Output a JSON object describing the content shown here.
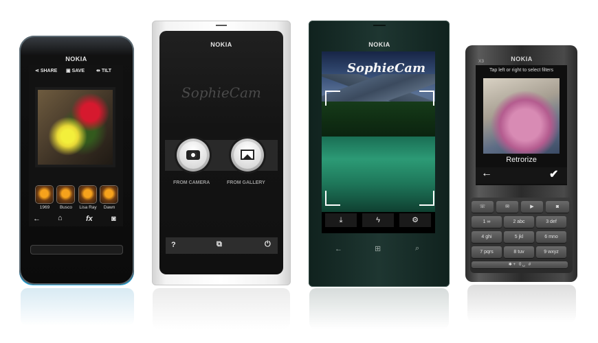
{
  "phone1": {
    "brand": "NOKIA",
    "toolbar": {
      "share": "SHARE",
      "save": "SAVE",
      "tilt": "TILT"
    },
    "filters": [
      "1969",
      "Busco",
      "Lisa Ray",
      "Dawn"
    ],
    "nav": {
      "back": "←",
      "home": "⌂",
      "fx": "fx",
      "camera": "◙"
    }
  },
  "phone2": {
    "brand": "NOKIA",
    "app_logo": "SophieCam",
    "from_camera": "FROM CAMERA",
    "from_gallery": "FROM GALLERY",
    "bottom": {
      "help": "?",
      "gallery": "⧉",
      "power": "⏻"
    }
  },
  "phone3": {
    "brand": "NOKIA",
    "app_logo": "SophieCam",
    "buttons": {
      "save": "⤓",
      "flash": "ϟ",
      "settings": "⚙"
    },
    "nav": {
      "back": "←",
      "start": "⊞",
      "search": "⌕"
    }
  },
  "phone4": {
    "brand": "NOKIA",
    "model": "X3",
    "hint": "Tap left or right to select filters",
    "filter_name": "Retrorize",
    "back": "←",
    "confirm": "✔",
    "keys": [
      "1 ∞",
      "2 abc",
      "3 def",
      "✱ +",
      "4 ghi",
      "5 jkl",
      "6 mno",
      "0 ␣",
      "7 pqrs",
      "8 tuv",
      "9 wxyz",
      "#"
    ]
  }
}
